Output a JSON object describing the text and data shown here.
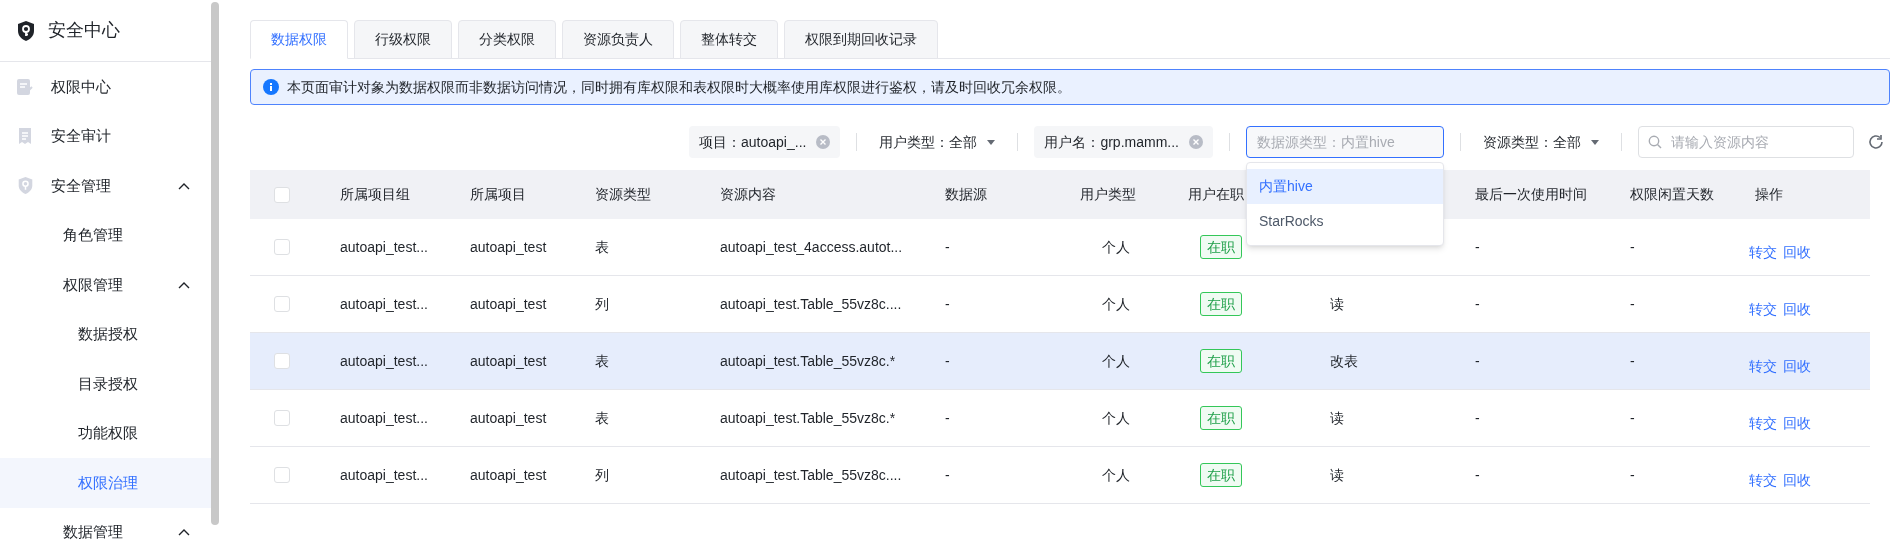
{
  "sidebar": {
    "title": "安全中心",
    "items": [
      {
        "label": "权限中心",
        "selected": false
      },
      {
        "label": "安全审计",
        "selected": false
      },
      {
        "label": "安全管理",
        "selected": false,
        "expanded": true,
        "children": [
          {
            "label": "角色管理",
            "selected": false
          },
          {
            "label": "权限管理",
            "selected": false,
            "expanded": true,
            "children": [
              {
                "label": "数据授权",
                "selected": false
              },
              {
                "label": "目录授权",
                "selected": false
              },
              {
                "label": "功能权限",
                "selected": false
              },
              {
                "label": "权限治理",
                "selected": true
              }
            ]
          },
          {
            "label": "数据管理",
            "selected": false,
            "expanded": true
          }
        ]
      }
    ]
  },
  "tabs": [
    {
      "label": "数据权限",
      "selected": true
    },
    {
      "label": "行级权限",
      "selected": false
    },
    {
      "label": "分类权限",
      "selected": false
    },
    {
      "label": "资源负责人",
      "selected": false
    },
    {
      "label": "整体转交",
      "selected": false
    },
    {
      "label": "权限到期回收记录",
      "selected": false
    }
  ],
  "notice": "本页面审计对象为数据权限而非数据访问情况，同时拥有库权限和表权限时大概率使用库权限进行鉴权，请及时回收冗余权限。",
  "filters": [
    {
      "kind": "chip",
      "text": "项目：autoapi_..."
    },
    {
      "kind": "select",
      "text": "用户类型：全部"
    },
    {
      "kind": "chip",
      "text": "用户名：grp.mamm..."
    },
    {
      "kind": "combo",
      "placeholder": "数据源类型：内置hive",
      "focused": true,
      "options": [
        {
          "label": "内置hive",
          "selected": true
        },
        {
          "label": "StarRocks",
          "selected": false
        }
      ]
    },
    {
      "kind": "select",
      "text": "资源类型：全部"
    },
    {
      "kind": "search",
      "placeholder": "请输入资源内容"
    }
  ],
  "table": {
    "all_checked": false,
    "columns": [
      "所属项目组",
      "所属项目",
      "资源类型",
      "资源内容",
      "数据源",
      "用户类型",
      "用户在职",
      null,
      "最后一次使用时间",
      "权限闲置天数",
      "操作"
    ],
    "rows": [
      {
        "checked": false,
        "highlighted": false,
        "cells": [
          "autoapi_test...",
          "autoapi_test",
          "表",
          "autoapi_test_4access.autot...",
          "-",
          "个人",
          "在职",
          null,
          "-",
          "-"
        ],
        "actions": [
          "转交",
          "回收"
        ]
      },
      {
        "checked": false,
        "highlighted": false,
        "cells": [
          "autoapi_test...",
          "autoapi_test",
          "列",
          "autoapi_test.Table_55vz8c....",
          "-",
          "个人",
          "在职",
          "读",
          "-",
          "-"
        ],
        "actions": [
          "转交",
          "回收"
        ]
      },
      {
        "checked": false,
        "highlighted": true,
        "cells": [
          "autoapi_test...",
          "autoapi_test",
          "表",
          "autoapi_test.Table_55vz8c.*",
          "-",
          "个人",
          "在职",
          "改表",
          "-",
          "-"
        ],
        "actions": [
          "转交",
          "回收"
        ]
      },
      {
        "checked": false,
        "highlighted": false,
        "cells": [
          "autoapi_test...",
          "autoapi_test",
          "表",
          "autoapi_test.Table_55vz8c.*",
          "-",
          "个人",
          "在职",
          "读",
          "-",
          "-"
        ],
        "actions": [
          "转交",
          "回收"
        ]
      },
      {
        "checked": false,
        "highlighted": false,
        "cells": [
          "autoapi_test...",
          "autoapi_test",
          "列",
          "autoapi_test.Table_55vz8c....",
          "-",
          "个人",
          "在职",
          "读",
          "-",
          "-"
        ],
        "actions": [
          "转交",
          "回收"
        ]
      }
    ]
  }
}
